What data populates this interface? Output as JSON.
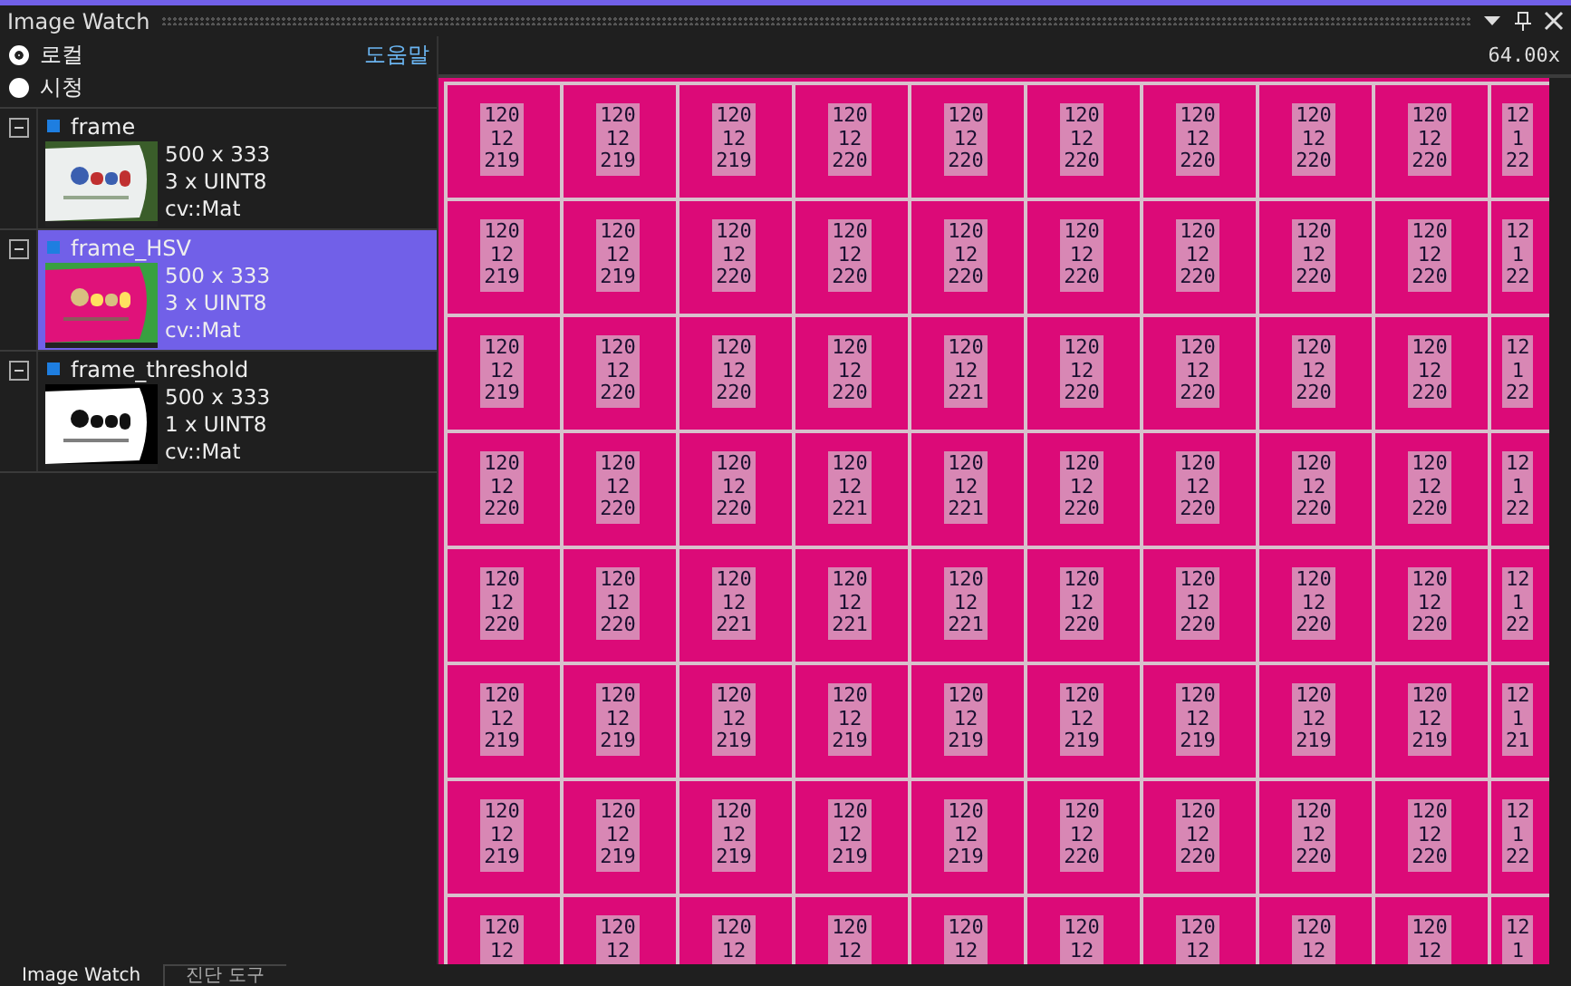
{
  "window": {
    "title": "Image Watch"
  },
  "scope": {
    "options": [
      {
        "label": "로컬",
        "selected": true
      },
      {
        "label": "시청",
        "selected": false
      }
    ],
    "help_link": "도움말"
  },
  "images": [
    {
      "name": "frame",
      "expanded": true,
      "selected": false,
      "size": "500 x 333",
      "channels": "3 x UINT8",
      "type": "cv::Mat"
    },
    {
      "name": "frame_HSV",
      "expanded": true,
      "selected": true,
      "size": "500 x 333",
      "channels": "3 x UINT8",
      "type": "cv::Mat"
    },
    {
      "name": "frame_threshold",
      "expanded": true,
      "selected": false,
      "size": "500 x 333",
      "channels": "1 x UINT8",
      "type": "cv::Mat"
    }
  ],
  "viewer": {
    "zoom": "64.00x",
    "pixels": [
      [
        [
          "120",
          "12",
          "219"
        ],
        [
          "120",
          "12",
          "219"
        ],
        [
          "120",
          "12",
          "219"
        ],
        [
          "120",
          "12",
          "220"
        ],
        [
          "120",
          "12",
          "220"
        ],
        [
          "120",
          "12",
          "220"
        ],
        [
          "120",
          "12",
          "220"
        ],
        [
          "120",
          "12",
          "220"
        ],
        [
          "120",
          "12",
          "220"
        ],
        [
          "12",
          "1",
          "22"
        ]
      ],
      [
        [
          "120",
          "12",
          "219"
        ],
        [
          "120",
          "12",
          "219"
        ],
        [
          "120",
          "12",
          "220"
        ],
        [
          "120",
          "12",
          "220"
        ],
        [
          "120",
          "12",
          "220"
        ],
        [
          "120",
          "12",
          "220"
        ],
        [
          "120",
          "12",
          "220"
        ],
        [
          "120",
          "12",
          "220"
        ],
        [
          "120",
          "12",
          "220"
        ],
        [
          "12",
          "1",
          "22"
        ]
      ],
      [
        [
          "120",
          "12",
          "219"
        ],
        [
          "120",
          "12",
          "220"
        ],
        [
          "120",
          "12",
          "220"
        ],
        [
          "120",
          "12",
          "220"
        ],
        [
          "120",
          "12",
          "221"
        ],
        [
          "120",
          "12",
          "220"
        ],
        [
          "120",
          "12",
          "220"
        ],
        [
          "120",
          "12",
          "220"
        ],
        [
          "120",
          "12",
          "220"
        ],
        [
          "12",
          "1",
          "22"
        ]
      ],
      [
        [
          "120",
          "12",
          "220"
        ],
        [
          "120",
          "12",
          "220"
        ],
        [
          "120",
          "12",
          "220"
        ],
        [
          "120",
          "12",
          "221"
        ],
        [
          "120",
          "12",
          "221"
        ],
        [
          "120",
          "12",
          "220"
        ],
        [
          "120",
          "12",
          "220"
        ],
        [
          "120",
          "12",
          "220"
        ],
        [
          "120",
          "12",
          "220"
        ],
        [
          "12",
          "1",
          "22"
        ]
      ],
      [
        [
          "120",
          "12",
          "220"
        ],
        [
          "120",
          "12",
          "220"
        ],
        [
          "120",
          "12",
          "221"
        ],
        [
          "120",
          "12",
          "221"
        ],
        [
          "120",
          "12",
          "221"
        ],
        [
          "120",
          "12",
          "220"
        ],
        [
          "120",
          "12",
          "220"
        ],
        [
          "120",
          "12",
          "220"
        ],
        [
          "120",
          "12",
          "220"
        ],
        [
          "12",
          "1",
          "22"
        ]
      ],
      [
        [
          "120",
          "12",
          "219"
        ],
        [
          "120",
          "12",
          "219"
        ],
        [
          "120",
          "12",
          "219"
        ],
        [
          "120",
          "12",
          "219"
        ],
        [
          "120",
          "12",
          "219"
        ],
        [
          "120",
          "12",
          "219"
        ],
        [
          "120",
          "12",
          "219"
        ],
        [
          "120",
          "12",
          "219"
        ],
        [
          "120",
          "12",
          "219"
        ],
        [
          "12",
          "1",
          "21"
        ]
      ],
      [
        [
          "120",
          "12",
          "219"
        ],
        [
          "120",
          "12",
          "219"
        ],
        [
          "120",
          "12",
          "219"
        ],
        [
          "120",
          "12",
          "219"
        ],
        [
          "120",
          "12",
          "219"
        ],
        [
          "120",
          "12",
          "220"
        ],
        [
          "120",
          "12",
          "220"
        ],
        [
          "120",
          "12",
          "220"
        ],
        [
          "120",
          "12",
          "220"
        ],
        [
          "12",
          "1",
          "22"
        ]
      ],
      [
        [
          "120",
          "12"
        ],
        [
          "120",
          "12"
        ],
        [
          "120",
          "12"
        ],
        [
          "120",
          "12"
        ],
        [
          "120",
          "12"
        ],
        [
          "120",
          "12"
        ],
        [
          "120",
          "12"
        ],
        [
          "120",
          "12"
        ],
        [
          "120",
          "12"
        ],
        [
          "12",
          "1"
        ]
      ]
    ]
  },
  "bottom_tabs": [
    {
      "label": "Image Watch",
      "selected": true
    },
    {
      "label": "진단 도구",
      "selected": false
    }
  ]
}
